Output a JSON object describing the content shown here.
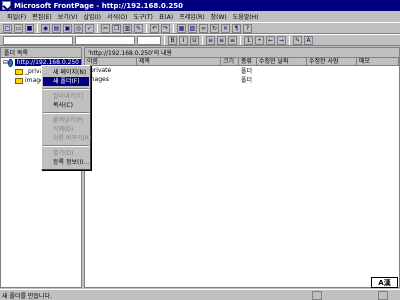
{
  "title": "Microsoft FrontPage - http://192.168.0.250",
  "menu": [
    "파일(F)",
    "편집(E)",
    "보기(V)",
    "삽입(I)",
    "서식(O)",
    "도구(T)",
    "표(A)",
    "프레임(R)",
    "창(W)",
    "도움말(H)"
  ],
  "left_pane": {
    "header": "폴더 목록",
    "root": "http://192.168.0.250",
    "children": [
      "_private",
      "images"
    ]
  },
  "right_pane": {
    "header": "'http://192.168.0.250'의 내용",
    "columns": [
      "이름",
      "제목",
      "크기",
      "종류",
      "수정한 날짜",
      "수정한 사람",
      "메모"
    ],
    "rows": [
      {
        "name": "_private",
        "type": "폴더"
      },
      {
        "name": "images",
        "type": "폴더"
      }
    ]
  },
  "context_menu": {
    "items": [
      {
        "label": "새 페이지(N)",
        "enabled": true,
        "selected": false
      },
      {
        "label": "새 폴더(F)",
        "enabled": true,
        "selected": true
      },
      {
        "sep": true
      },
      {
        "label": "잘라내기(T)",
        "enabled": false
      },
      {
        "label": "복사(C)",
        "enabled": true
      },
      {
        "sep": true
      },
      {
        "label": "붙여넣기(P)",
        "enabled": false
      },
      {
        "label": "삭제(D)",
        "enabled": false
      },
      {
        "label": "이름 바꾸기(R)",
        "enabled": false
      },
      {
        "sep": true
      },
      {
        "label": "열기(O)",
        "enabled": false
      },
      {
        "label": "등록 정보(I)...",
        "enabled": true
      }
    ]
  },
  "status": "새 폴더를 만듭니다.",
  "ime": "A漢"
}
